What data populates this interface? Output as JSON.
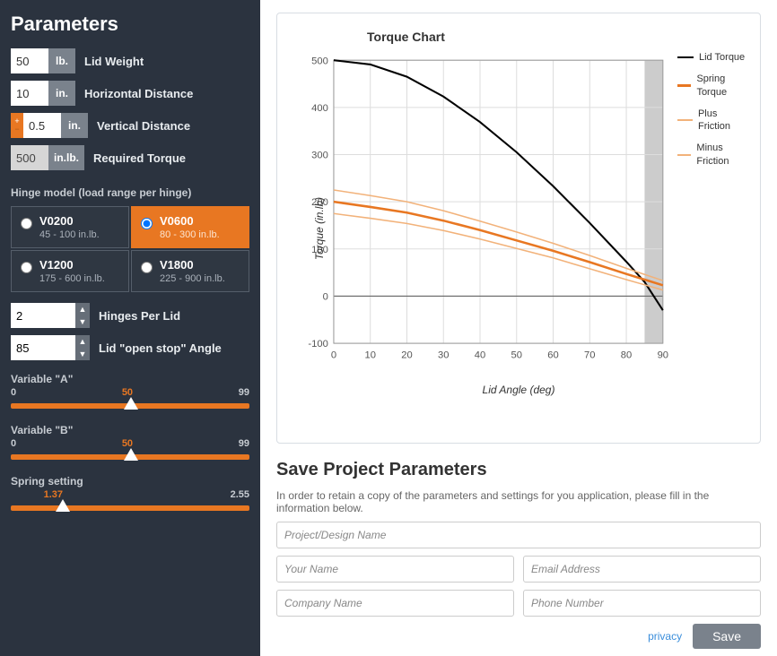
{
  "sidebar": {
    "title": "Parameters",
    "params": {
      "lid_weight": {
        "value": "50",
        "unit": "lb.",
        "label": "Lid Weight"
      },
      "h_distance": {
        "value": "10",
        "unit": "in.",
        "label": "Horizontal Distance"
      },
      "v_distance": {
        "value": "0.5",
        "unit": "in.",
        "label": "Vertical Distance",
        "signed": true
      },
      "req_torque": {
        "value": "500",
        "unit": "in.lb.",
        "label": "Required Torque",
        "readonly": true
      }
    },
    "hinge_header": "Hinge model (load range per hinge)",
    "hinge_models": [
      {
        "name": "V0200",
        "range": "45 - 100 in.lb.",
        "selected": false
      },
      {
        "name": "V0600",
        "range": "80 - 300 in.lb.",
        "selected": true
      },
      {
        "name": "V1200",
        "range": "175 - 600 in.lb.",
        "selected": false
      },
      {
        "name": "V1800",
        "range": "225 - 900 in.lb.",
        "selected": false
      }
    ],
    "spinners": {
      "hinges_per_lid": {
        "value": "2",
        "label": "Hinges Per Lid"
      },
      "open_stop": {
        "value": "85",
        "label": "Lid \"open stop\" Angle"
      }
    },
    "sliders": {
      "var_a": {
        "label": "Variable \"A\"",
        "min": "0",
        "mid": "50",
        "max": "99",
        "value": 50
      },
      "var_b": {
        "label": "Variable \"B\"",
        "min": "0",
        "mid": "50",
        "max": "99",
        "value": 50
      },
      "spring": {
        "label": "Spring setting",
        "min_blank": "",
        "mid": "1.37",
        "max": "2.55",
        "value": 20
      }
    }
  },
  "chart_data": {
    "type": "line",
    "title": "Torque Chart",
    "xlabel": "Lid Angle (deg)",
    "ylabel": "Torque (in.lb)",
    "xlim": [
      0,
      90
    ],
    "ylim": [
      -100,
      500
    ],
    "xticks": [
      0,
      10,
      20,
      30,
      40,
      50,
      60,
      70,
      80,
      90
    ],
    "yticks": [
      -100,
      0,
      100,
      200,
      300,
      400,
      500
    ],
    "open_stop_angle": 85,
    "series": [
      {
        "name": "Lid Torque",
        "color": "#000000",
        "width": 2,
        "x": [
          0,
          10,
          20,
          30,
          40,
          50,
          60,
          70,
          80,
          85,
          90
        ],
        "y": [
          500,
          491,
          465,
          423,
          369,
          305,
          233,
          155,
          73,
          30,
          -30
        ]
      },
      {
        "name": "Spring Torque",
        "color": "#e87722",
        "width": 2.5,
        "x": [
          0,
          10,
          20,
          30,
          40,
          50,
          60,
          70,
          80,
          85,
          90
        ],
        "y": [
          200,
          189,
          177,
          160,
          140,
          118,
          96,
          72,
          47,
          35,
          23
        ]
      },
      {
        "name": "Plus Friction",
        "color": "#f2b27a",
        "width": 1.5,
        "x": [
          0,
          10,
          20,
          30,
          40,
          50,
          60,
          70,
          80,
          85,
          90
        ],
        "y": [
          225,
          213,
          200,
          181,
          159,
          136,
          112,
          86,
          59,
          46,
          33
        ]
      },
      {
        "name": "Minus Friction",
        "color": "#f2b27a",
        "width": 1.5,
        "x": [
          0,
          10,
          20,
          30,
          40,
          50,
          60,
          70,
          80,
          85,
          90
        ],
        "y": [
          175,
          165,
          154,
          139,
          121,
          101,
          81,
          58,
          35,
          24,
          13
        ]
      }
    ]
  },
  "colors": {
    "accent": "#e87722"
  },
  "save": {
    "title": "Save Project Parameters",
    "desc": "In order to retain a copy of the parameters and settings for you application, please fill in the information below.",
    "project_name": "Project/Design Name",
    "your_name": "Your Name",
    "email": "Email Address",
    "company": "Company Name",
    "phone": "Phone Number",
    "privacy": "privacy",
    "save_btn": "Save"
  }
}
